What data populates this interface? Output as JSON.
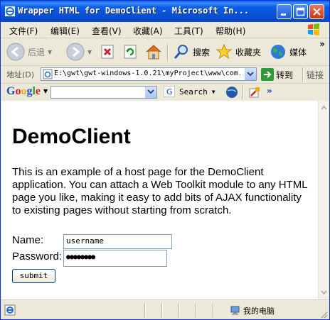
{
  "window": {
    "title": "Wrapper HTML for DemoClient - Microsoft In..."
  },
  "menu": {
    "items": [
      "文件(F)",
      "编辑(E)",
      "查看(V)",
      "收藏(A)",
      "工具(T)",
      "帮助(H)"
    ]
  },
  "toolbar": {
    "back_label": "后退",
    "search_label": "搜索",
    "favorites_label": "收藏夹",
    "media_label": "媒体",
    "more": "»"
  },
  "address": {
    "label": "地址(D)",
    "value": "E:\\gwt\\gwt-windows-1.0.21\\myProject\\www\\com.",
    "go_label": "转到",
    "links_label": "链接"
  },
  "google_bar": {
    "logo": "Google",
    "search_label": "Search",
    "more": "»"
  },
  "page": {
    "heading": "DemoClient",
    "intro": "This is an example of a host page for the DemoClient application. You can attach a Web Toolkit module to any HTML page you like, making it easy to add bits of AJAX functionality to existing pages without starting from scratch.",
    "name_label": "Name:",
    "name_value": "username",
    "password_label": "Password:",
    "password_value": "●●●●●●●●",
    "submit_label": "submit"
  },
  "status": {
    "zone": "我的电脑"
  },
  "colors": {
    "title_bar": "#0a5fe8",
    "close_button": "#c53a13",
    "chrome": "#ece9d8",
    "input_border": "#7f9db9"
  }
}
